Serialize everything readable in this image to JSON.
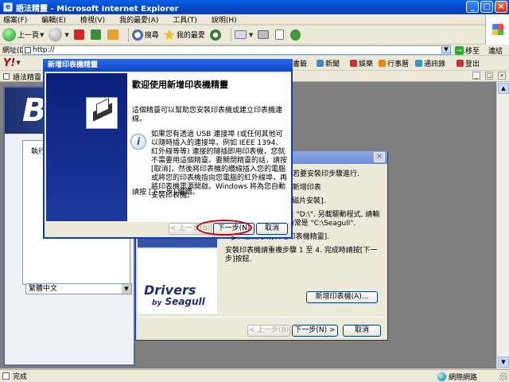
{
  "window": {
    "title": "語法精靈 - Microsoft Internet Explorer"
  },
  "menu": [
    "檔案(F)",
    "編輯(E)",
    "檢視(V)",
    "我的最愛(A)",
    "工具(T)",
    "說明(H)"
  ],
  "toolbar": {
    "back": "上一頁",
    "search": "搜尋",
    "favorites": "我的最愛"
  },
  "address": {
    "label": "網址(D)",
    "value": "http://",
    "go": "移至",
    "links": "連結"
  },
  "yahoo": {
    "logo": "Y!",
    "items": [
      "書籤",
      "新聞",
      "娛樂",
      "行事曆",
      "通訊錄",
      "登出"
    ]
  },
  "tab": {
    "label": "語法精靈"
  },
  "app": {
    "banner": "B",
    "run_label": "執行",
    "language": "繁體中文"
  },
  "wizard_front": {
    "title": "新增印表機精靈",
    "heading": "歡迎使用新增印表機精靈",
    "intro": "這個精靈可以幫助您安裝印表機或建立印表機連線。",
    "info": "如果您有透過 USB 連接埠 (或任何其他可以隨時插入的連接埠，例如 IEEE 1394、紅外線等等) 連接的隨插即用印表機，您就不需要用這個精靈。要關閉精靈的話，請按 [取消]，然後將印表機的纜線插入您的電腦或將您的印表機指向您電腦的紅外線埠，再將印表機電源開啟。Windows 將為您自動安裝印表機。",
    "continue": "請按 [下一步] 繼續。",
    "btn_back": "< 上一步(B)",
    "btn_next": "下一步(N) >",
    "btn_cancel": "取消"
  },
  "wizard_back": {
    "lines": [
      "安裝], 請按[下一步]. 若要安裝印步驟進行.",
      "鈕]按鈕, 將開始執行[新增印表",
      "驅動程式時, 請按 [從磁片安裝].",
      "光碟機的目錄, 通常是 \"D:\\\". 另載驅動程式, 請輸入抽出檔案的位置, 通常是 \"C:\\Seagull\".",
      "4) 繼續完成[新增印表機精靈].",
      "安裝印表機請重複步驟 1 至 4. 完成時請按[下一步]按鈕."
    ],
    "logo_top": "Drivers",
    "logo_by": "by",
    "logo_bottom": "Seagull",
    "btn_add": "新增印表機(A)...",
    "btn_back": "< 上一步(B)",
    "btn_next": "下一步(N) >",
    "btn_cancel": "取消"
  },
  "status": {
    "left": "完成",
    "zone": "網際網路"
  }
}
